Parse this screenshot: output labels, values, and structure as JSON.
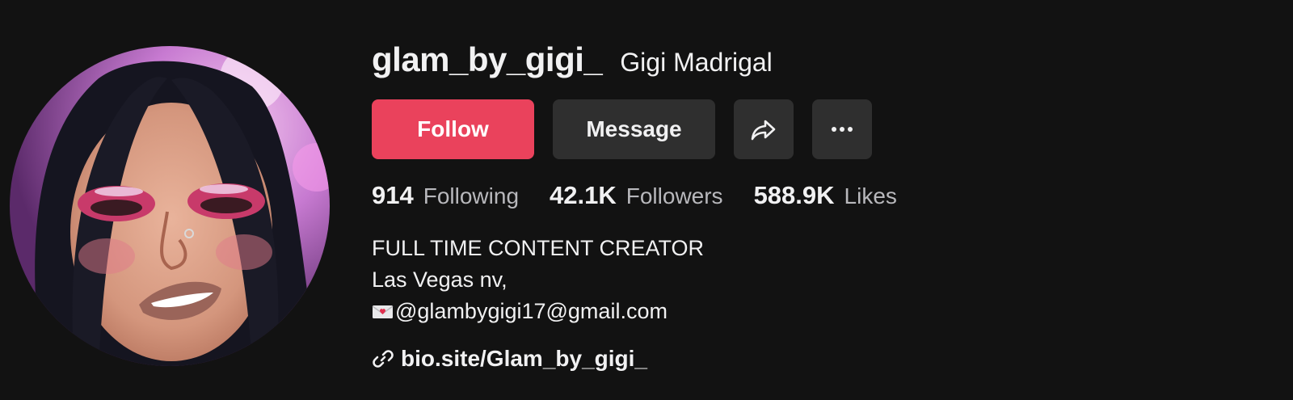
{
  "profile": {
    "username": "glam_by_gigi_",
    "nickname": "Gigi Madrigal",
    "avatar_alt": "avatar"
  },
  "actions": {
    "follow_label": "Follow",
    "message_label": "Message",
    "share_icon": "share-arrow-icon",
    "more_icon": "more-dots-icon"
  },
  "stats": {
    "following_count": "914",
    "following_label": "Following",
    "followers_count": "42.1K",
    "followers_label": "Followers",
    "likes_count": "588.9K",
    "likes_label": "Likes"
  },
  "bio": {
    "line1": "FULL TIME CONTENT CREATOR",
    "line2": "Las Vegas nv,",
    "line3": "@glambygigi17@gmail.com",
    "line3_icon": "love-letter-envelope-icon"
  },
  "link": {
    "icon": "link-chain-icon",
    "text": "bio.site/Glam_by_gigi_"
  },
  "colors": {
    "background": "#121212",
    "follow_button": "#ea425c",
    "secondary_button": "#2f2f2f",
    "text_primary": "#f1f1f2",
    "text_secondary": "#b8b8bc"
  }
}
